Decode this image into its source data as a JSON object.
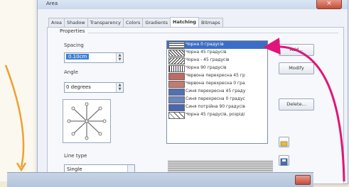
{
  "window": {
    "title": "Area",
    "close": "×"
  },
  "tabs": [
    "Area",
    "Shadow",
    "Transparency",
    "Colors",
    "Gradients",
    "Hatching",
    "Bitmaps"
  ],
  "properties": {
    "group_label": "Properties",
    "spacing_label": "Spacing",
    "spacing_value": "0.10cm",
    "angle_label": "Angle",
    "angle_value": "0 degrees",
    "line_type_label": "Line type",
    "line_type_value": "Single"
  },
  "hatch_list": [
    {
      "label": "Чорна 0 градусів",
      "swatch": "#2a2a2a"
    },
    {
      "label": "Чорна 45 градусів",
      "swatch": "#3a3a3a"
    },
    {
      "label": "Чорна - 45 градусів",
      "swatch": "#3a3a3a"
    },
    {
      "label": "Чорна 90 градусів",
      "swatch": "#3a3a3a"
    },
    {
      "label": "Червона перехресна 45 гр",
      "swatch": "#c05050"
    },
    {
      "label": "Червона перехресна 0 гра",
      "swatch": "#c05050"
    },
    {
      "label": "Синя перехресна 45 граду",
      "swatch": "#4060b0"
    },
    {
      "label": "Синя перехресна 0 градус",
      "swatch": "#4060b0"
    },
    {
      "label": "Синя потрійна 90 градусів",
      "swatch": "#4060b0"
    },
    {
      "label": "Чорна 45 градусів, розріді",
      "swatch": "#555555"
    }
  ],
  "buttons": {
    "add": "Add...",
    "modify": "Modify",
    "delete": "Delete..."
  },
  "colors": {
    "accent": "#3b6fc6",
    "arrow_pink": "#e0157a",
    "arrow_orange": "#f0a030"
  }
}
